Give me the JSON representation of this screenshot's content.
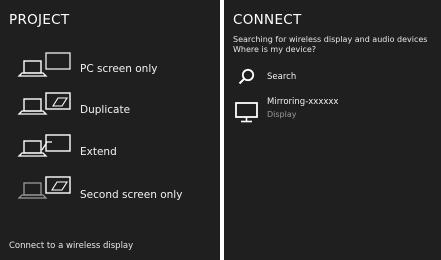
{
  "project": {
    "title": "PROJECT",
    "options": [
      {
        "label": "PC screen only",
        "icon": "pc-screen-only-icon"
      },
      {
        "label": "Duplicate",
        "icon": "duplicate-icon"
      },
      {
        "label": "Extend",
        "icon": "extend-icon"
      },
      {
        "label": "Second screen only",
        "icon": "second-screen-only-icon"
      }
    ],
    "footer_link": "Connect to a wireless display"
  },
  "connect": {
    "title": "CONNECT",
    "searching_text": "Searching for wireless display and audio devices",
    "help_link": "Where is my device?",
    "search_label": "Search",
    "device": {
      "name": "Mirroring-xxxxxx",
      "type": "Display",
      "icon": "monitor-icon"
    }
  },
  "colors": {
    "panel_bg": "#1f1f1f",
    "divider": "#ffffff",
    "text": "#ffffff",
    "secondary_text": "#9a9a9a"
  }
}
